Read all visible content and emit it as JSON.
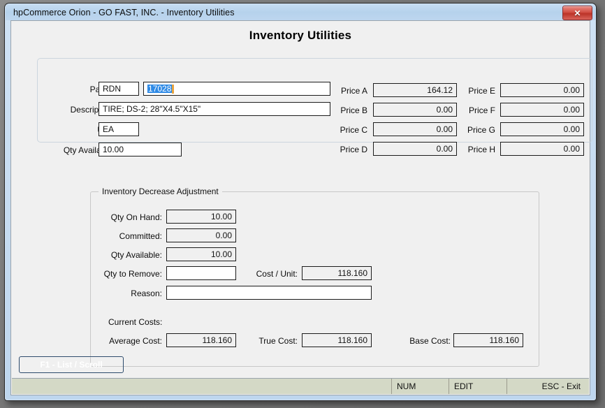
{
  "window": {
    "title": "hpCommerce Orion - GO FAST, INC. - Inventory Utilities",
    "close_label": "✕"
  },
  "page": {
    "heading": "Inventory Utilities"
  },
  "header_fields": {
    "part_label": "Part #:",
    "part_prefix_value": "RDN",
    "part_number_value": "17028",
    "description_label": "Description:",
    "description_value": "TIRE; DS-2; 28\"X4.5\"X15\"",
    "unit_label": "Unit:",
    "unit_value": "EA",
    "qty_available_label": "Qty Available:",
    "qty_available_value": "10.00"
  },
  "prices": {
    "left": [
      {
        "label": "Price A",
        "value": "164.12"
      },
      {
        "label": "Price B",
        "value": "0.00"
      },
      {
        "label": "Price C",
        "value": "0.00"
      },
      {
        "label": "Price D",
        "value": "0.00"
      }
    ],
    "right": [
      {
        "label": "Price E",
        "value": "0.00"
      },
      {
        "label": "Price F",
        "value": "0.00"
      },
      {
        "label": "Price G",
        "value": "0.00"
      },
      {
        "label": "Price H",
        "value": "0.00"
      }
    ]
  },
  "adjustment": {
    "group_label": "Inventory Decrease Adjustment",
    "qty_on_hand_label": "Qty On Hand:",
    "qty_on_hand_value": "10.00",
    "committed_label": "Committed:",
    "committed_value": "0.00",
    "qty_available_label": "Qty Available:",
    "qty_available_value": "10.00",
    "qty_to_remove_label": "Qty to Remove:",
    "qty_to_remove_value": "",
    "cost_per_unit_label": "Cost / Unit:",
    "cost_per_unit_value": "118.160",
    "reason_label": "Reason:",
    "reason_value": ""
  },
  "current_costs": {
    "section_label": "Current Costs:",
    "average_cost_label": "Average Cost:",
    "average_cost_value": "118.160",
    "true_cost_label": "True Cost:",
    "true_cost_value": "118.160",
    "base_cost_label": "Base Cost:",
    "base_cost_value": "118.160"
  },
  "actions": {
    "f1_label": "F1 - List / Scroll"
  },
  "statusbar": {
    "message": "",
    "num": "NUM",
    "edit": "EDIT",
    "esc": "ESC - Exit"
  },
  "colors": {
    "titlebar": "#bdd6ef",
    "close_button": "#c73f33",
    "selection": "#2e8ae6",
    "caret": "#e8a33d",
    "f1_button": "#345f8a",
    "statusbar": "#d4d9c6",
    "client": "#f0f0f0"
  }
}
